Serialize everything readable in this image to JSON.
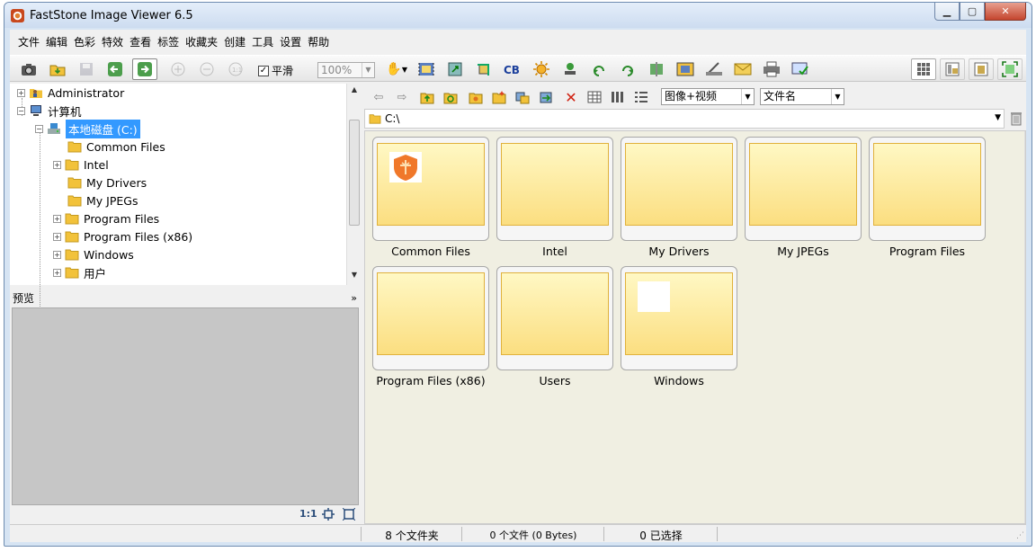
{
  "window": {
    "title": "FastStone Image Viewer 6.5",
    "min": "▁",
    "max": "▢",
    "close": "✕"
  },
  "menu": [
    "文件",
    "编辑",
    "色彩",
    "特效",
    "查看",
    "标签",
    "收藏夹",
    "创建",
    "工具",
    "设置",
    "帮助"
  ],
  "toolbar": {
    "smooth_label": "平滑",
    "smooth_checked": "✓",
    "zoom_value": "100%"
  },
  "tree": [
    {
      "label": "Administrator",
      "depth": 0,
      "expander": "+",
      "icon": "user-folder-icon"
    },
    {
      "label": "计算机",
      "depth": 0,
      "expander": "−",
      "icon": "computer-icon"
    },
    {
      "label": "本地磁盘 (C:)",
      "depth": 1,
      "expander": "−",
      "icon": "drive-icon",
      "selected": true
    },
    {
      "label": "Common Files",
      "depth": 2,
      "expander": "",
      "icon": "folder-icon"
    },
    {
      "label": "Intel",
      "depth": 2,
      "expander": "+",
      "icon": "folder-icon"
    },
    {
      "label": "My Drivers",
      "depth": 2,
      "expander": "",
      "icon": "folder-icon"
    },
    {
      "label": "My JPEGs",
      "depth": 2,
      "expander": "",
      "icon": "folder-icon"
    },
    {
      "label": "Program Files",
      "depth": 2,
      "expander": "+",
      "icon": "folder-icon"
    },
    {
      "label": "Program Files (x86)",
      "depth": 2,
      "expander": "+",
      "icon": "folder-icon"
    },
    {
      "label": "Windows",
      "depth": 2,
      "expander": "+",
      "icon": "folder-icon"
    },
    {
      "label": "用户",
      "depth": 2,
      "expander": "+",
      "icon": "folder-icon"
    }
  ],
  "preview": {
    "title": "预览",
    "collapse": "»",
    "ratio_label": "1:1"
  },
  "browser": {
    "filter_value": "图像+视频",
    "sort_value": "文件名",
    "path": "C:\\"
  },
  "folders": [
    {
      "name": "Common Files",
      "overlay": "shield"
    },
    {
      "name": "Intel",
      "overlay": ""
    },
    {
      "name": "My Drivers",
      "overlay": ""
    },
    {
      "name": "My JPEGs",
      "overlay": ""
    },
    {
      "name": "Program Files",
      "overlay": ""
    },
    {
      "name": "Program Files (x86)",
      "overlay": ""
    },
    {
      "name": "Users",
      "overlay": ""
    },
    {
      "name": "Windows",
      "overlay": "blank"
    }
  ],
  "status": {
    "folders": "8 个文件夹",
    "files": "0 个文件 (0 Bytes)",
    "selected": "0 已选择"
  },
  "colors": {
    "selection": "#3399ff",
    "folder_fill": "#fbde80",
    "accent_close": "#c4452e"
  }
}
